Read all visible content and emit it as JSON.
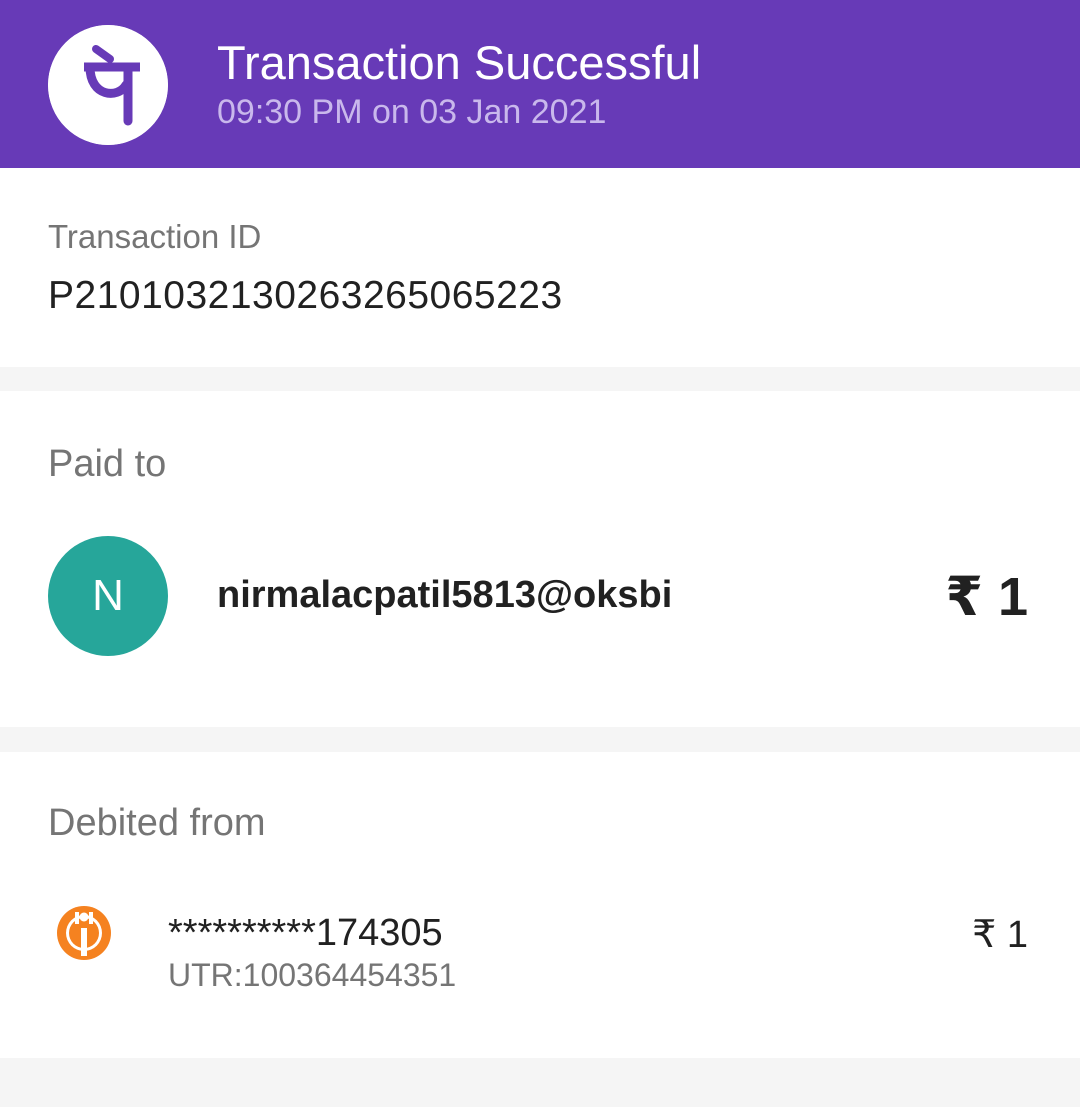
{
  "header": {
    "logo_glyph": "पे",
    "title": "Transaction Successful",
    "datetime": "09:30 PM on 03 Jan 2021",
    "bg_color": "#673ab7"
  },
  "transaction": {
    "label": "Transaction ID",
    "id": "P2101032130263265065223"
  },
  "paid_to": {
    "label": "Paid to",
    "avatar_initial": "N",
    "avatar_color": "#26a69a",
    "payee": "nirmalacpatil5813@oksbi",
    "amount": "₹ 1"
  },
  "debited_from": {
    "label": "Debited from",
    "bank_icon": "bank-logo-icon",
    "account": "**********174305",
    "utr": "UTR:100364454351",
    "amount": "₹ 1"
  }
}
